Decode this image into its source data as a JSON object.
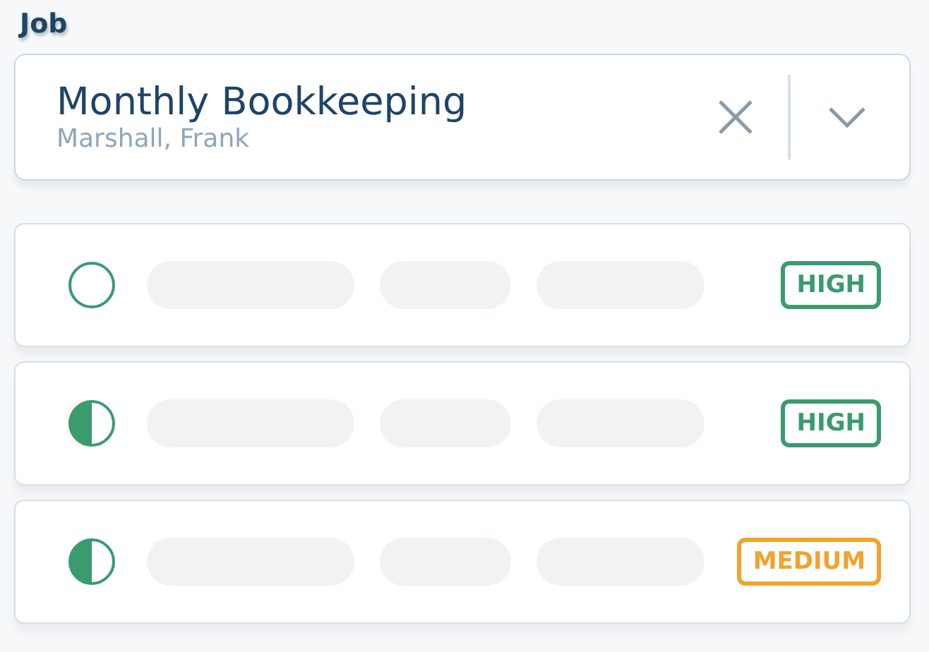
{
  "label": "Job",
  "field": {
    "value": "Monthly Bookkeeping",
    "subtitle": "Marshall, Frank"
  },
  "rows": [
    {
      "kind": "empty",
      "priority": "HIGH",
      "color": "#3a9b6e"
    },
    {
      "kind": "half",
      "priority": "HIGH",
      "color": "#3a9b6e"
    },
    {
      "kind": "half",
      "priority": "MEDIUM",
      "color": "#f0a32e"
    }
  ]
}
